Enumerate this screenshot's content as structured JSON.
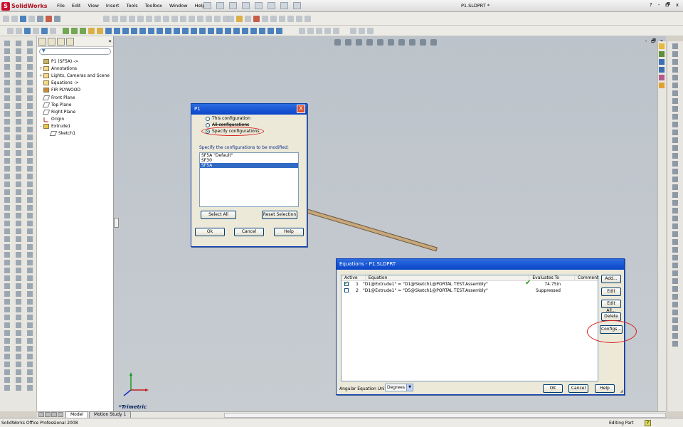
{
  "app": {
    "logo": "SolidWorks",
    "menus": [
      "File",
      "Edit",
      "View",
      "Insert",
      "Tools",
      "Toolbox",
      "Window",
      "Help"
    ],
    "document_title": "P1.SLDPRT *",
    "window_buttons": [
      "?",
      "-",
      "🗗",
      "x"
    ]
  },
  "feature_tree": {
    "items": [
      {
        "label": "P1  (SF5A) ->",
        "exp": ""
      },
      {
        "label": "Annotations",
        "exp": "+"
      },
      {
        "label": "Lights, Cameras and Scene",
        "exp": "+"
      },
      {
        "label": "Equations ->",
        "exp": ""
      },
      {
        "label": "FIR PLYWOOD",
        "exp": ""
      },
      {
        "label": "Front Plane",
        "exp": ""
      },
      {
        "label": "Top Plane",
        "exp": ""
      },
      {
        "label": "Right Plane",
        "exp": ""
      },
      {
        "label": "Origin",
        "exp": ""
      },
      {
        "label": "Extrude1",
        "exp": "-"
      },
      {
        "label": "Sketch1",
        "exp": ""
      }
    ]
  },
  "viewport": {
    "view_name": "*Trimetric",
    "window_buttons": [
      "-",
      "🗗",
      "x"
    ]
  },
  "bottom_tabs": [
    "Model",
    "Motion Study 1"
  ],
  "status": {
    "left": "SolidWorks Office Professional 2008",
    "mode": "Editing Part",
    "help": "?"
  },
  "p1_dialog": {
    "title": "P1",
    "close": "X",
    "options": [
      "This configuration",
      "All configurations",
      "Specify configurations"
    ],
    "selected_option": 2,
    "list_label": "Specify the configurations to be modified:",
    "configurations": [
      {
        "name": "SF5A \"Default\"",
        "selected": false
      },
      {
        "name": "SF30",
        "selected": false
      },
      {
        "name": "SF5A",
        "selected": true
      }
    ],
    "buttons": {
      "select_all": "Select All",
      "reset_selection": "Reset Selection",
      "ok": "Ok",
      "cancel": "Cancel",
      "help": "Help"
    }
  },
  "equations_dialog": {
    "title": "Equations - P1.SLDPRT",
    "headers": [
      "Active",
      "Equation",
      "Evaluates To",
      "Comment"
    ],
    "rows": [
      {
        "active": true,
        "num": "1",
        "equation": "\"D1@Extrude1\" = \"D1@Sketch1@PORTAL TEST.Assembly\"",
        "evaluates": "74.75in",
        "valid": true
      },
      {
        "active": false,
        "num": "2",
        "equation": "\"D1@Extrude1\" = \"D5@Sketch1@PORTAL TEST.Assembly\"",
        "evaluates": "Suppressed",
        "valid": false
      }
    ],
    "side_buttons": [
      "Add...",
      "Edit",
      "Edit All...",
      "Delete",
      "Configs..."
    ],
    "units_label": "Angular Equation Units:",
    "units_value": "Degrees",
    "buttons": {
      "ok": "OK",
      "cancel": "Cancel",
      "help": "Help"
    }
  }
}
